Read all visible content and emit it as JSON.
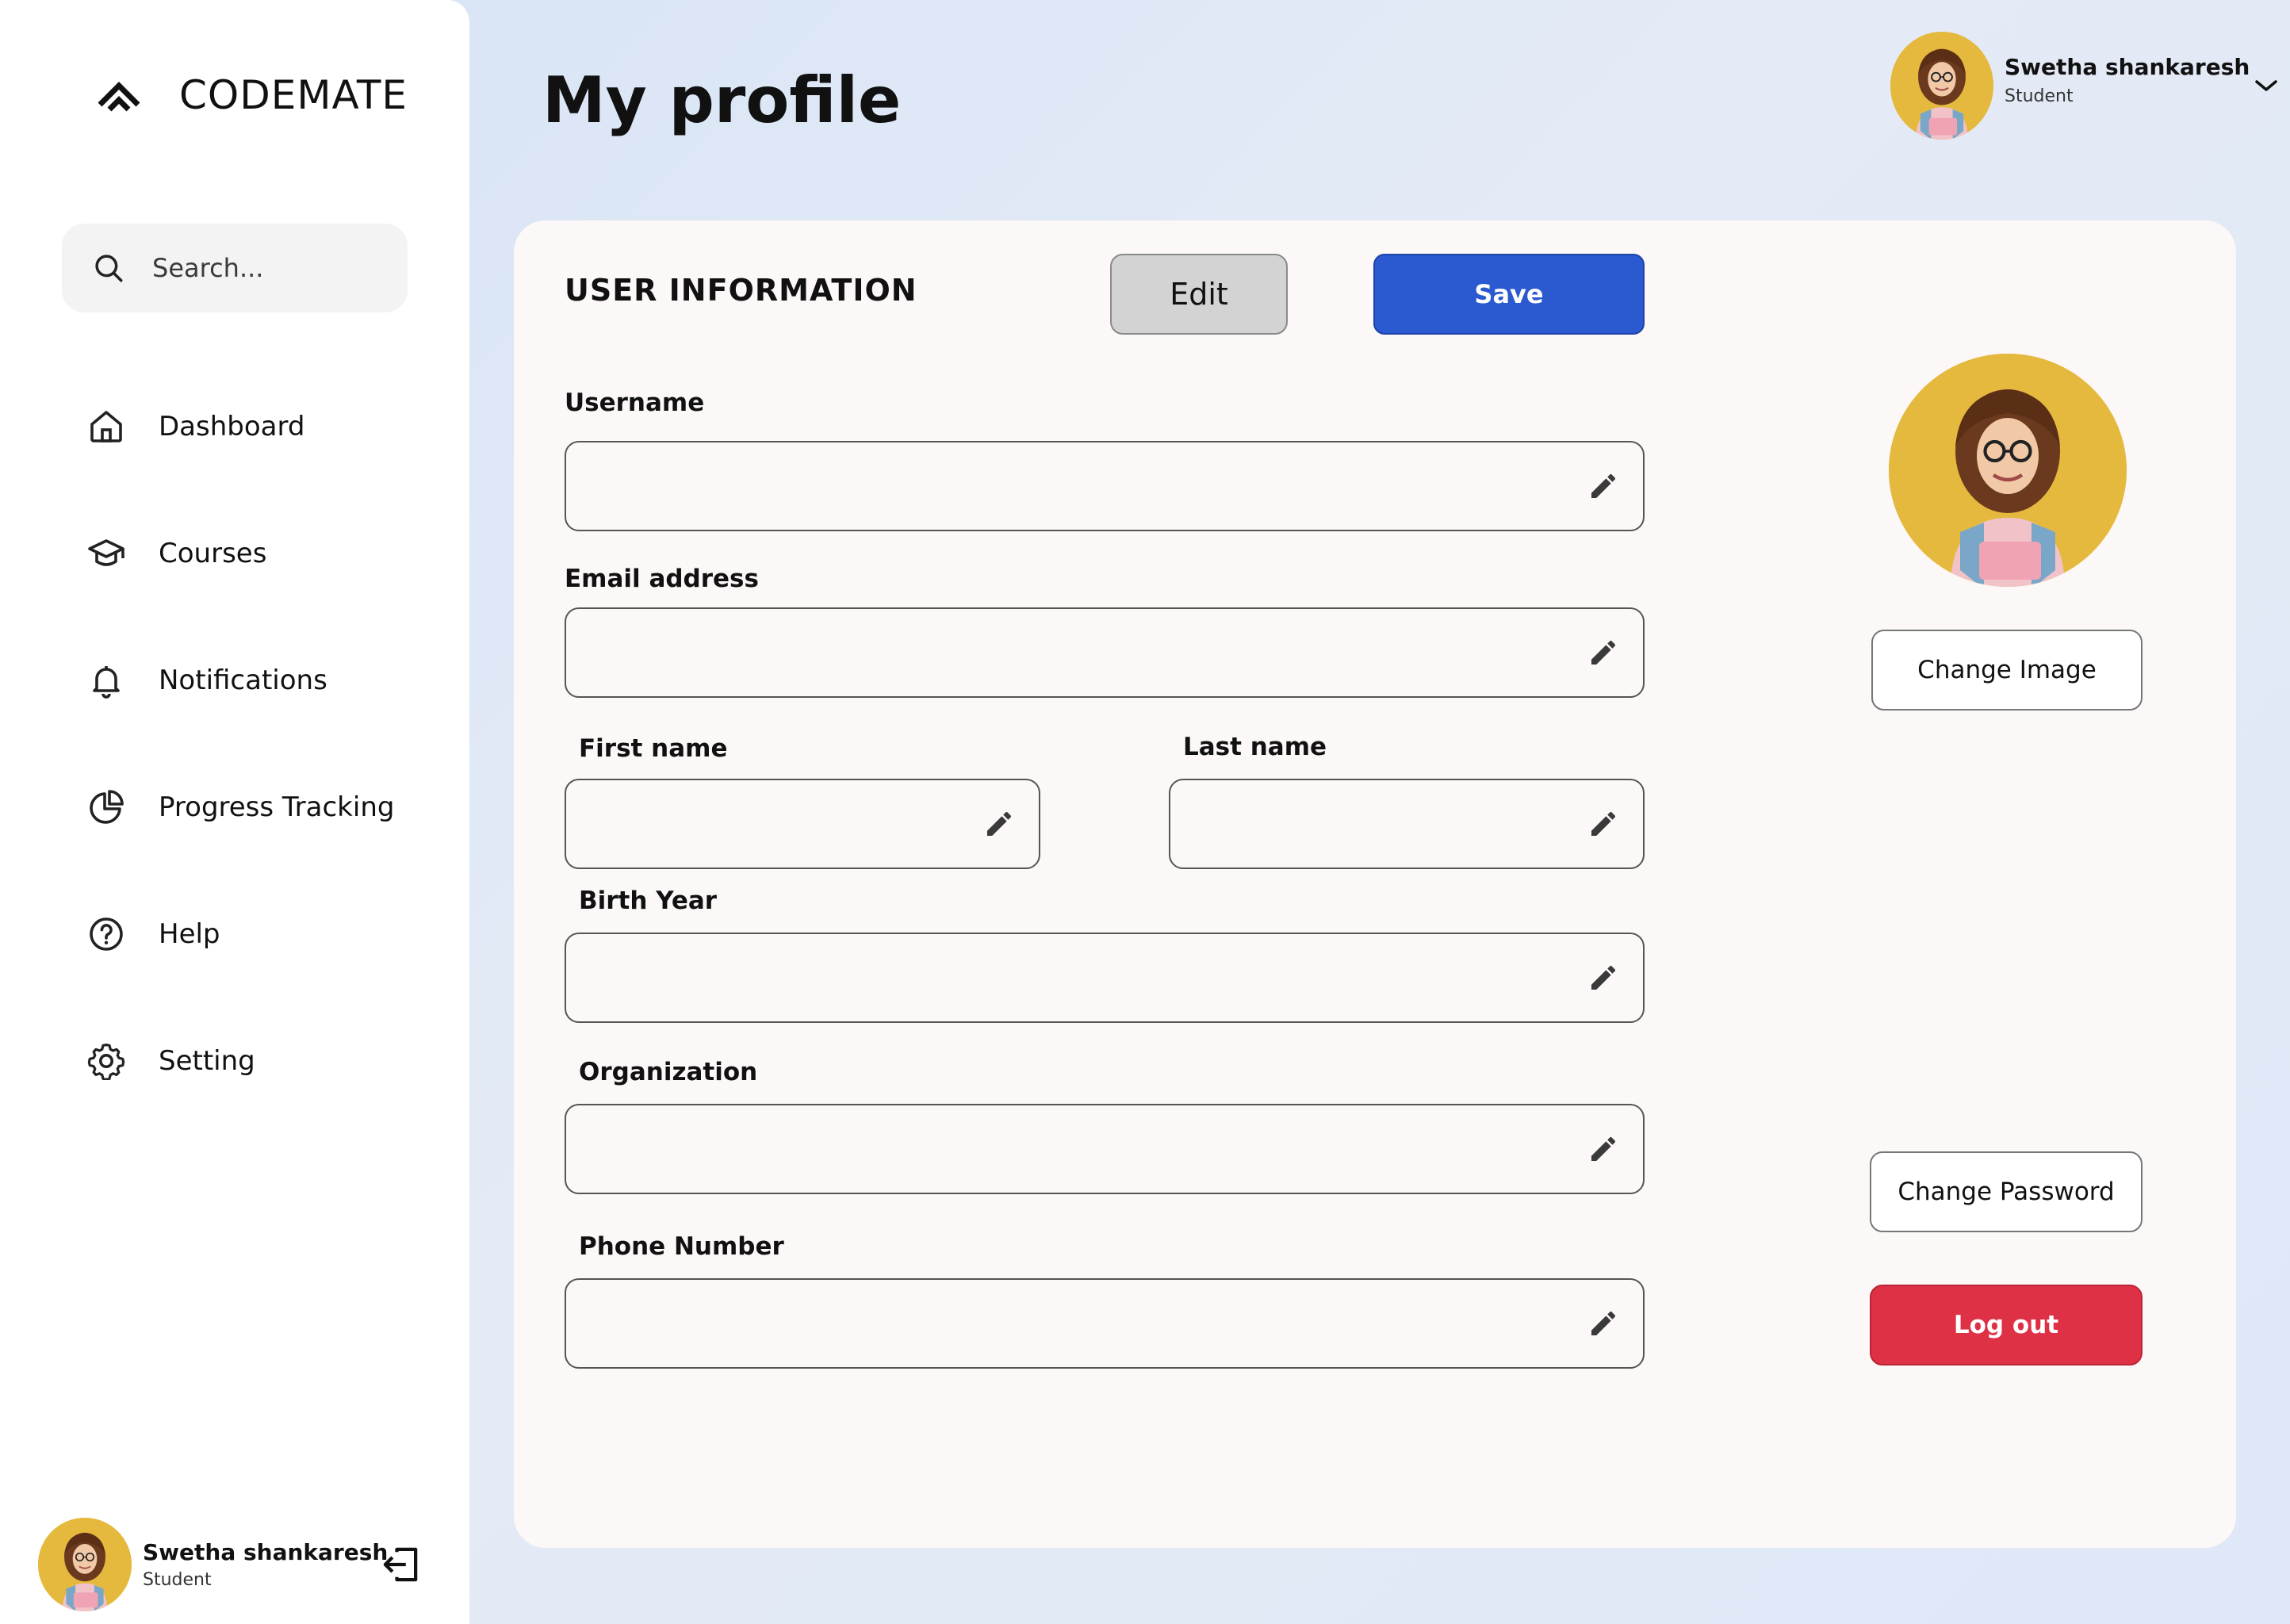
{
  "app": {
    "brand": "CODEMATE"
  },
  "search": {
    "placeholder": "Search..."
  },
  "sidebar": {
    "items": [
      {
        "label": "Dashboard",
        "icon": "home-icon"
      },
      {
        "label": "Courses",
        "icon": "graduation-cap-icon"
      },
      {
        "label": "Notifications",
        "icon": "bell-icon"
      },
      {
        "label": "Progress Tracking",
        "icon": "pie-chart-icon"
      },
      {
        "label": "Help",
        "icon": "help-circle-icon"
      },
      {
        "label": "Setting",
        "icon": "gear-icon"
      }
    ]
  },
  "user": {
    "name": "Swetha shankaresh",
    "role": "Student"
  },
  "header": {
    "title": "My profile"
  },
  "card": {
    "title": "USER INFORMATION",
    "edit_label": "Edit",
    "save_label": "Save",
    "fields": {
      "username": {
        "label": "Username",
        "value": ""
      },
      "email": {
        "label": "Email address",
        "value": ""
      },
      "first_name": {
        "label": "First name",
        "value": ""
      },
      "last_name": {
        "label": "Last name",
        "value": ""
      },
      "birth_year": {
        "label": "Birth Year",
        "value": ""
      },
      "organization": {
        "label": "Organization",
        "value": ""
      },
      "phone": {
        "label": "Phone Number",
        "value": ""
      }
    },
    "change_image_label": "Change Image",
    "change_password_label": "Change Password",
    "logout_label": "Log out"
  },
  "colors": {
    "primary": "#2b59d0",
    "danger": "#df3146",
    "avatar_bg": "#e5b93e"
  }
}
